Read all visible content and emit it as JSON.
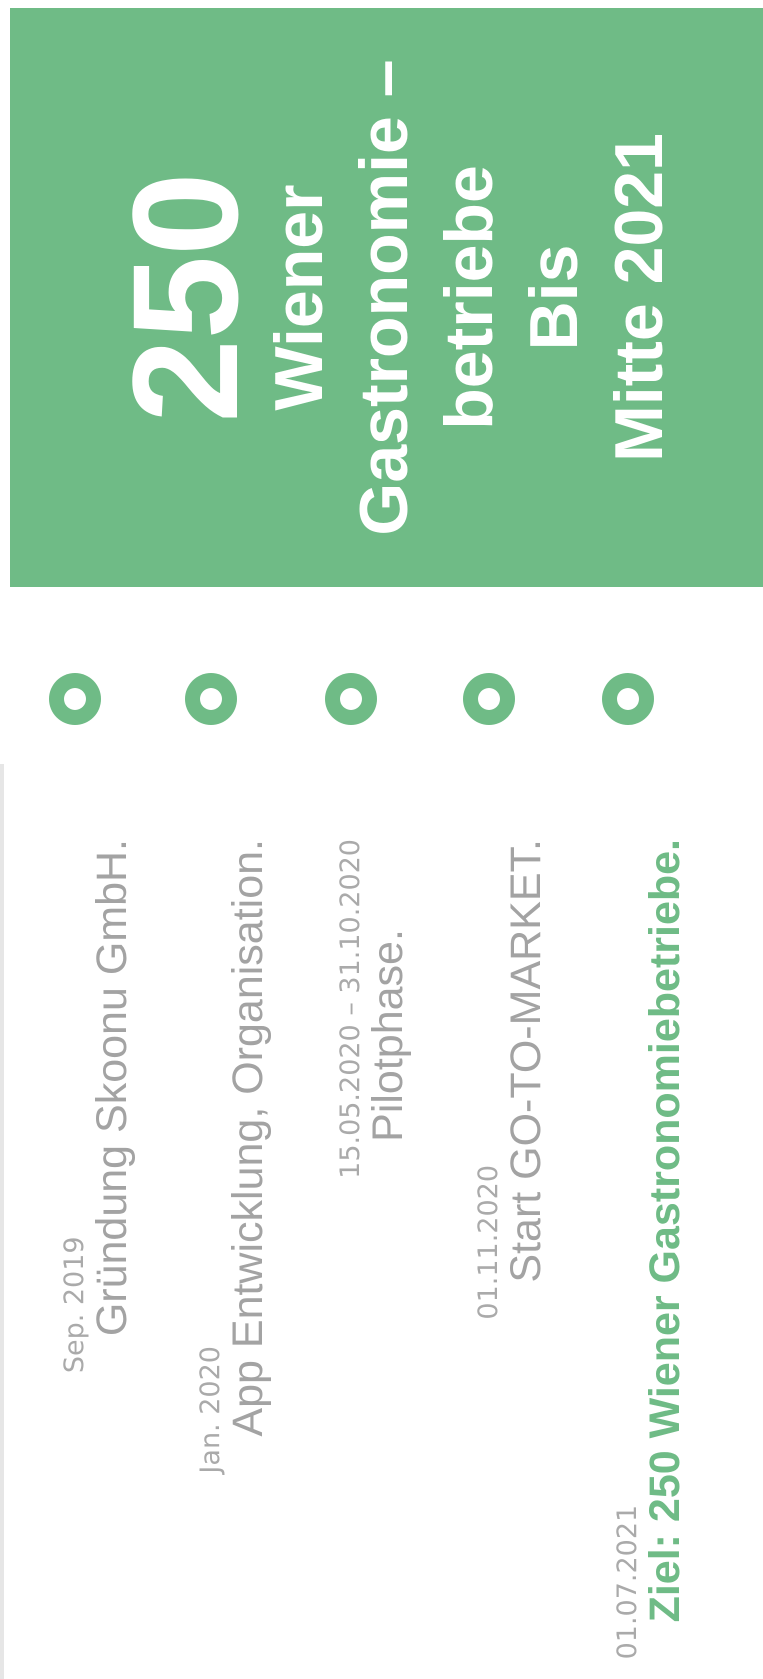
{
  "timeline": [
    {
      "date": "Sep. 2019",
      "label": "Gründung Skoonu GmbH."
    },
    {
      "date": "Jan. 2020",
      "label": "App Entwicklung, Organisation."
    },
    {
      "date": "15.05.2020 – 31.10.2020",
      "label": "Pilotphase."
    },
    {
      "date": "01.11.2020",
      "label": "Start GO-TO-MARKET."
    },
    {
      "date": "01.07.2021",
      "label": "Ziel: 250 Wiener Gastronomiebetriebe."
    }
  ],
  "goal_box": {
    "number": "250",
    "lines": [
      "Wiener",
      "Gastronomie –",
      "betriebe",
      "Bis",
      "Mitte 2021"
    ]
  },
  "colors": {
    "accent": "#6fbb86",
    "muted_text": "#a3a3a3",
    "timeline_line": "#e6e6e6"
  }
}
